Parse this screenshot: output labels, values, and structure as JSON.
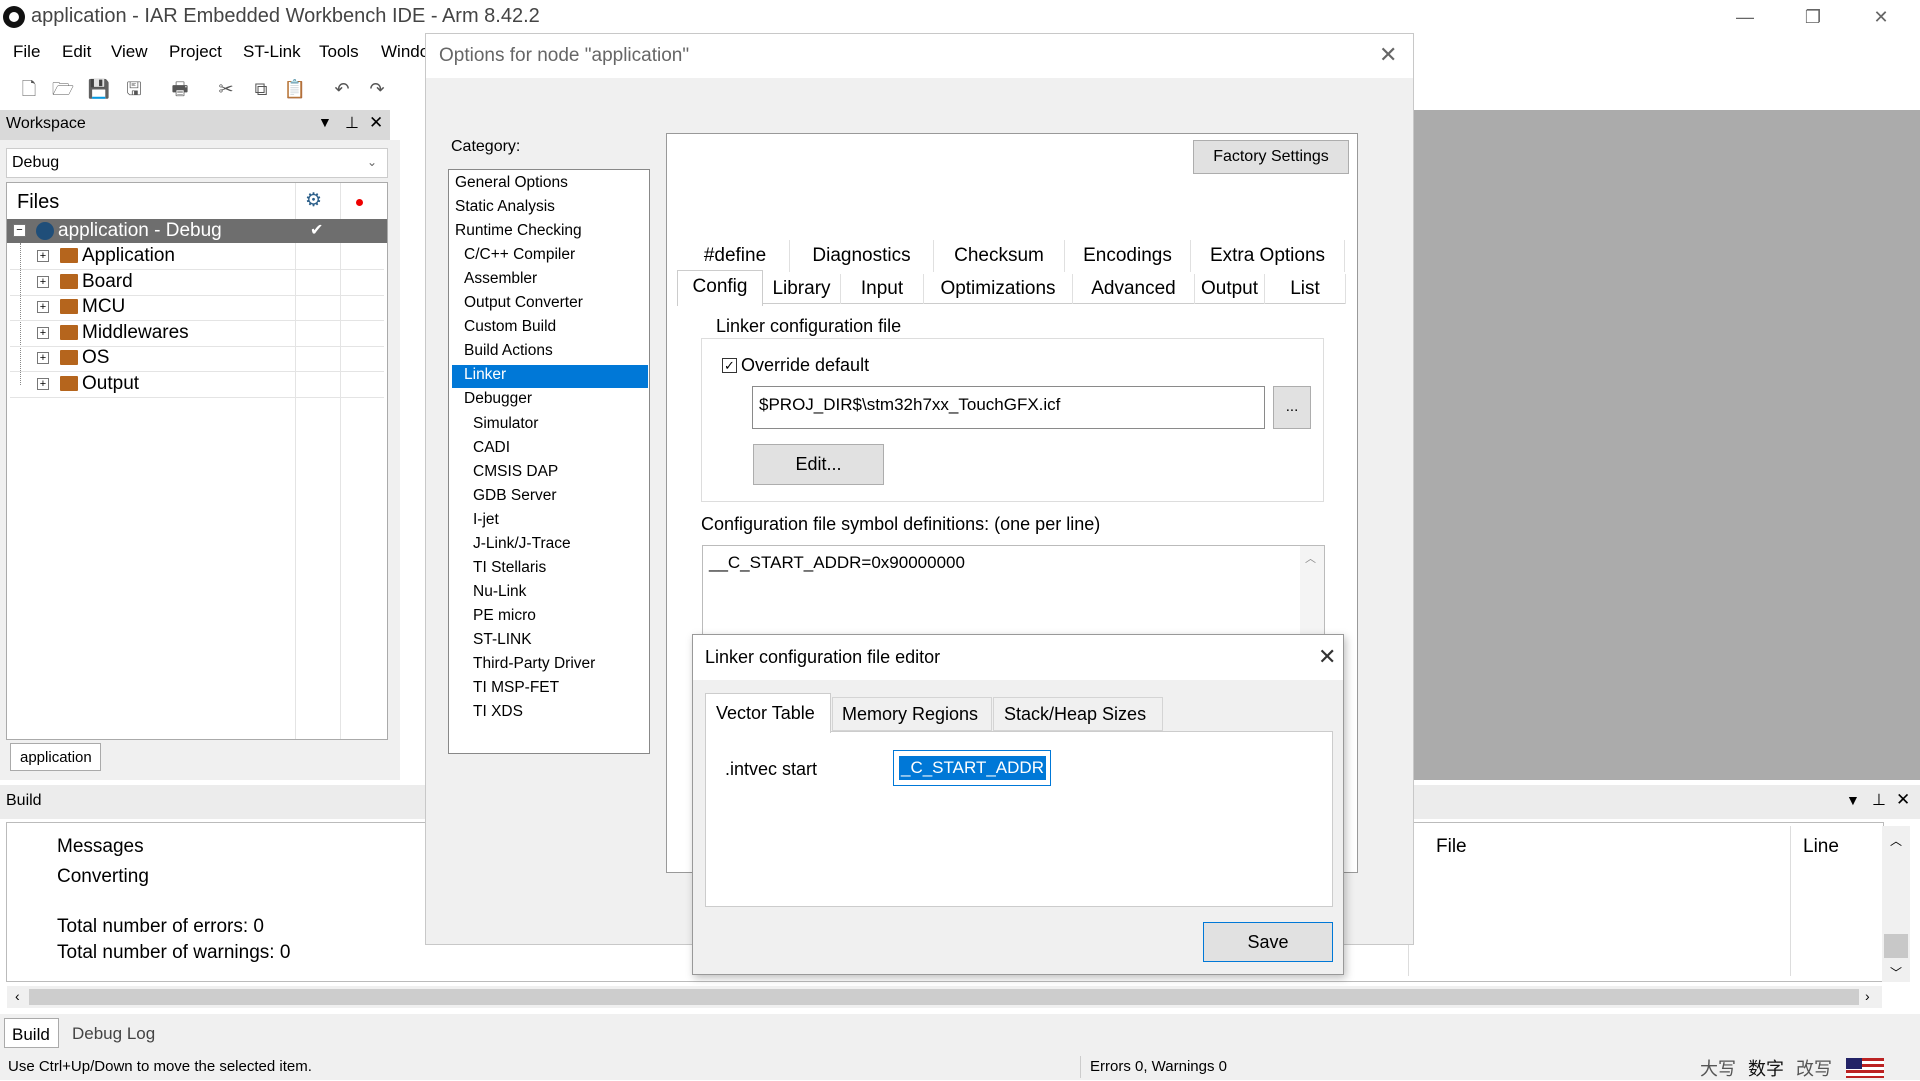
{
  "window": {
    "title": "application - IAR Embedded Workbench IDE - Arm 8.42.2",
    "minimize": "—",
    "restore": "❐",
    "close": "✕"
  },
  "menu": [
    "File",
    "Edit",
    "View",
    "Project",
    "ST-Link",
    "Tools",
    "Windo"
  ],
  "workspace": {
    "header": "Workspace",
    "config": "Debug",
    "files_label": "Files",
    "root": "application - Debug",
    "folders": [
      "Application",
      "Board",
      "MCU",
      "Middlewares",
      "OS",
      "Output"
    ],
    "tab": "application"
  },
  "build": {
    "header": "Build",
    "col_messages": "Messages",
    "col_file": "File",
    "col_line": "Line",
    "lines": [
      "Converting",
      "",
      "Total number of errors: 0",
      "Total number of warnings: 0"
    ],
    "tabs": [
      "Build",
      "Debug Log"
    ]
  },
  "status": {
    "hint": "Use Ctrl+Up/Down to move the selected item.",
    "counts": "Errors 0, Warnings 0",
    "ime": [
      "大写",
      "数字",
      "改写"
    ]
  },
  "options": {
    "title": "Options for node \"application\"",
    "category_label": "Category:",
    "categories": [
      {
        "label": "General Options",
        "indent": 0
      },
      {
        "label": "Static Analysis",
        "indent": 0
      },
      {
        "label": "Runtime Checking",
        "indent": 0
      },
      {
        "label": "C/C++ Compiler",
        "indent": 1
      },
      {
        "label": "Assembler",
        "indent": 1
      },
      {
        "label": "Output Converter",
        "indent": 1
      },
      {
        "label": "Custom Build",
        "indent": 1
      },
      {
        "label": "Build Actions",
        "indent": 1
      },
      {
        "label": "Linker",
        "indent": 1,
        "selected": true
      },
      {
        "label": "Debugger",
        "indent": 1
      },
      {
        "label": "Simulator",
        "indent": 2
      },
      {
        "label": "CADI",
        "indent": 2
      },
      {
        "label": "CMSIS DAP",
        "indent": 2
      },
      {
        "label": "GDB Server",
        "indent": 2
      },
      {
        "label": "I-jet",
        "indent": 2
      },
      {
        "label": "J-Link/J-Trace",
        "indent": 2
      },
      {
        "label": "TI Stellaris",
        "indent": 2
      },
      {
        "label": "Nu-Link",
        "indent": 2
      },
      {
        "label": "PE micro",
        "indent": 2
      },
      {
        "label": "ST-LINK",
        "indent": 2
      },
      {
        "label": "Third-Party Driver",
        "indent": 2
      },
      {
        "label": "TI MSP-FET",
        "indent": 2
      },
      {
        "label": "TI XDS",
        "indent": 2
      }
    ],
    "factory_settings": "Factory Settings",
    "tabs_row1": [
      "#define",
      "Diagnostics",
      "Checksum",
      "Encodings",
      "Extra Options"
    ],
    "tabs_row2": [
      "Config",
      "Library",
      "Input",
      "Optimizations",
      "Advanced",
      "Output",
      "List"
    ],
    "active_tab": "Config",
    "linker_group": "Linker configuration file",
    "override_label": "Override default",
    "override_checked": true,
    "icf_path": "$PROJ_DIR$\\stm32h7xx_TouchGFX.icf",
    "browse": "...",
    "edit_button": "Edit...",
    "symbol_label": "Configuration file symbol definitions: (one per line)",
    "symbol_text": "__C_START_ADDR=0x90000000"
  },
  "editor": {
    "title": "Linker configuration file editor",
    "tabs": [
      "Vector Table",
      "Memory Regions",
      "Stack/Heap Sizes"
    ],
    "intvec_label": ".intvec start",
    "intvec_value": "_C_START_ADDR",
    "save": "Save"
  },
  "colors": {
    "selection": "#0078d7",
    "mdi_gray": "#ababab"
  }
}
